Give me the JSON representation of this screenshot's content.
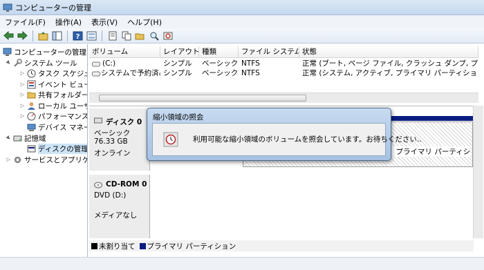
{
  "window": {
    "title": "コンピューターの管理"
  },
  "menu": [
    "ファイル(F)",
    "操作(A)",
    "表示(V)",
    "ヘルプ(H)"
  ],
  "toolbar_icons": [
    "back-icon",
    "forward-icon",
    "up-folder-icon",
    "show-hide-tree-icon",
    "help-icon",
    "console-icon",
    "properties-icon",
    "copy-icon",
    "open-folder-icon",
    "search-icon",
    "refresh-icon"
  ],
  "tree": [
    {
      "label": "コンピューターの管理",
      "icon": "computer-management-icon",
      "indent": 0,
      "arrow": ""
    },
    {
      "label": "システム ツール",
      "icon": "system-tools-icon",
      "indent": 1,
      "arrow": "▲"
    },
    {
      "label": "タスク スケジュ",
      "icon": "task-scheduler-icon",
      "indent": 2,
      "arrow": "▷"
    },
    {
      "label": "イベント ビュー",
      "icon": "event-viewer-icon",
      "indent": 2,
      "arrow": "▷"
    },
    {
      "label": "共有フォルダー",
      "icon": "shared-folder-icon",
      "indent": 2,
      "arrow": "▷"
    },
    {
      "label": "ローカル ユーザ",
      "icon": "local-users-icon",
      "indent": 2,
      "arrow": "▷"
    },
    {
      "label": "パフォーマンス",
      "icon": "performance-icon",
      "indent": 2,
      "arrow": "▷"
    },
    {
      "label": "デバイス マネー",
      "icon": "device-manager-icon",
      "indent": 2,
      "arrow": ""
    },
    {
      "label": "記憶域",
      "icon": "storage-icon",
      "indent": 1,
      "arrow": "▲"
    },
    {
      "label": "ディスクの管理",
      "icon": "disk-management-icon",
      "indent": 2,
      "arrow": ""
    },
    {
      "label": "サービスとアプリケ",
      "icon": "services-icon",
      "indent": 1,
      "arrow": "▷"
    }
  ],
  "columns": [
    "ボリューム",
    "レイアウト",
    "種類",
    "ファイル システム",
    "状態"
  ],
  "volumes": [
    {
      "volume": "(C:)",
      "layout": "シンプル",
      "type": "ベーシック",
      "fs": "NTFS",
      "status": "正常 (ブート, ページ ファイル, クラッシュ ダンプ, プライマ"
    },
    {
      "volume": "システムで予約済み",
      "layout": "シンプル",
      "type": "ベーシック",
      "fs": "NTFS",
      "status": "正常 (システム, アクティブ, プライマリ パーティション)"
    }
  ],
  "disk0": {
    "name": "ディスク 0",
    "type": "ベーシック",
    "size": "76.33 GB",
    "state": "オンライン",
    "partition_fragment": "、プライマリ パーティシ"
  },
  "cdrom0": {
    "name": "CD-ROM 0",
    "drive": "DVD (D:)",
    "media": "メディアなし"
  },
  "legend": [
    {
      "label": "未割り当て",
      "color": "#000000"
    },
    {
      "label": "プライマリ パーティション",
      "color": "#0a1d80"
    }
  ],
  "dialog": {
    "title": "縮小領域の照会",
    "message": "利用可能な縮小領域のボリュームを照会しています。お待ちください..",
    "icon": "clock-icon"
  },
  "colors": {
    "primary_partition": "#0a1d80",
    "selection": "#cde4f7",
    "dialog_frame": "#a7c2e2"
  }
}
